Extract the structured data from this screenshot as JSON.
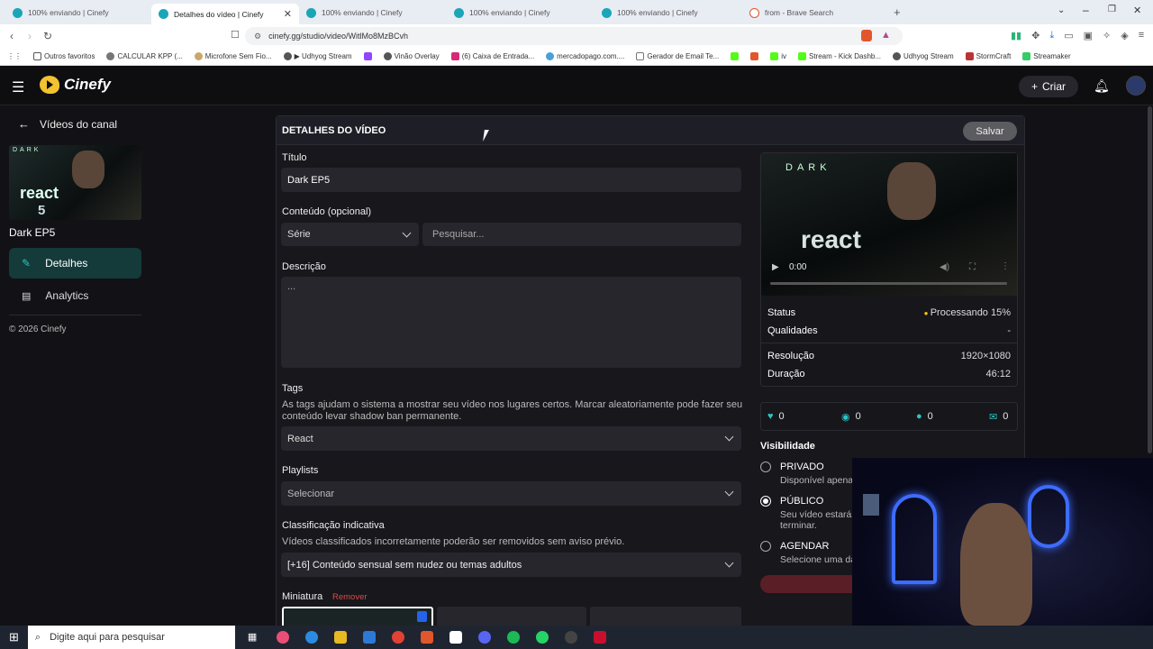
{
  "browser": {
    "tabs": [
      {
        "label": "100% enviando | Cinefy"
      },
      {
        "label": "Detalhes do vídeo | Cinefy"
      },
      {
        "label": "100% enviando | Cinefy"
      },
      {
        "label": "100% enviando | Cinefy"
      },
      {
        "label": "100% enviando | Cinefy"
      },
      {
        "label": "from - Brave Search"
      }
    ],
    "url": "cinefy.gg/studio/video/WitlMo8MzBCvh",
    "bookmarks": [
      "Outros favoritos",
      "CALCULAR KPP (...",
      "Microfone Sem Fio...",
      "▶ Udhyog Stream",
      "",
      "Vinão Overlay",
      "(6) Caixa de Entrada...",
      "mercadopago.com....",
      "Gerador de Email Te...",
      "",
      "",
      "iv",
      "Stream - Kick Dashb...",
      "Udhyog Stream",
      "StormCraft",
      "Streamaker"
    ]
  },
  "app": {
    "logo": "Cinefy",
    "criar": "Criar"
  },
  "sidebar": {
    "back": "Vídeos do canal",
    "video_title": "Dark EP5",
    "thumb_text": "react",
    "thumb_num": "5",
    "thumb_brand": "DARK",
    "items": [
      {
        "label": "Detalhes"
      },
      {
        "label": "Analytics"
      }
    ],
    "footer": "© 2026 Cinefy"
  },
  "panel": {
    "heading": "DETALHES DO VÍDEO",
    "save": "Salvar",
    "titulo_label": "Título",
    "titulo_value": "Dark EP5",
    "conteudo_label": "Conteúdo (opcional)",
    "conteudo_select": "Série",
    "conteudo_search": "Pesquisar...",
    "descricao_label": "Descrição",
    "descricao_value": "...",
    "tags_label": "Tags",
    "tags_help": "As tags ajudam o sistema a mostrar seu vídeo nos lugares certos. Marcar aleatoriamente pode fazer seu conteúdo levar shadow ban permanente.",
    "tags_value": "React",
    "playlists_label": "Playlists",
    "playlists_value": "Selecionar",
    "class_label": "Classificação indicativa",
    "class_help": "Vídeos classificados incorretamente poderão ser removidos sem aviso prévio.",
    "class_value": "[+16] Conteúdo sensual sem nudez ou temas adultos",
    "miniatura_label": "Miniatura",
    "remover": "Remover"
  },
  "video_info": {
    "time": "0:00",
    "status_label": "Status",
    "status_value": "Processando 15%",
    "qualidades_label": "Qualidades",
    "qualidades_value": "-",
    "resolucao_label": "Resolução",
    "resolucao_value": "1920×1080",
    "duracao_label": "Duração",
    "duracao_value": "46:12",
    "stats": [
      "0",
      "0",
      "0",
      "0"
    ]
  },
  "visibility": {
    "label": "Visibilidade",
    "options": [
      {
        "title": "PRIVADO",
        "desc": "Disponível apena"
      },
      {
        "title": "PÚBLICO",
        "desc": "Seu vídeo estará",
        "desc2": "terminar."
      },
      {
        "title": "AGENDAR",
        "desc": "Selecione uma da"
      }
    ]
  },
  "taskbar": {
    "search": "Digite aqui para pesquisar"
  }
}
